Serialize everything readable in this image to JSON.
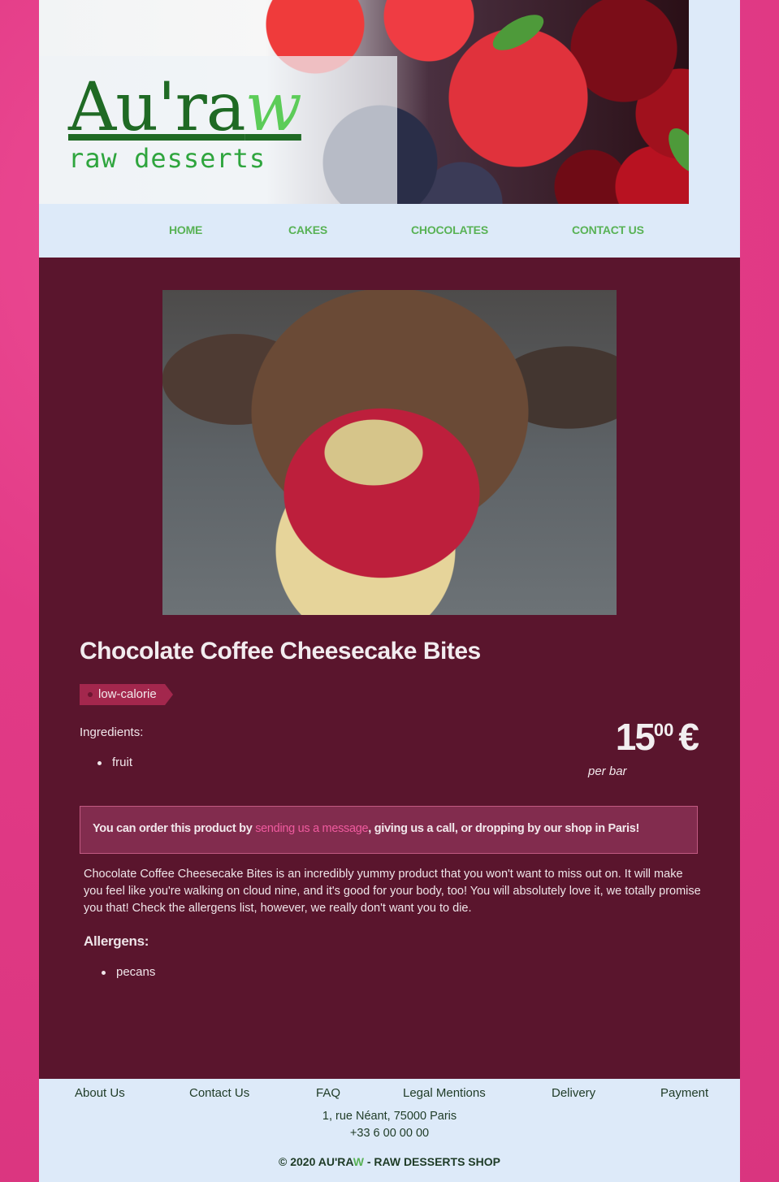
{
  "brand": {
    "logo_main": "Au'ra",
    "logo_accent": "w",
    "tagline": "raw desserts"
  },
  "nav": {
    "home": "HOME",
    "cakes": "CAKES",
    "chocolates": "CHOCOLATES",
    "contact": "CONTACT US"
  },
  "product": {
    "title": "Chocolate Coffee Cheesecake Bites",
    "tag": "low-calorie",
    "ingredients_label": "Ingredients:",
    "ingredients": [
      "fruit"
    ],
    "price_int": "15",
    "price_cents": "00",
    "currency": "€",
    "per_unit": "per bar",
    "order_prefix": "You can order this product by ",
    "order_link": "sending us a message",
    "order_suffix": ", giving us a call, or dropping by our shop in Paris!",
    "description": "Chocolate Coffee Cheesecake Bites is an incredibly yummy product that you won't want to miss out on. It will make you feel like you're walking on cloud nine, and it's good for your body, too! You will absolutely love it, we totally promise you that! Check the allergens list, however, we really don't want you to die.",
    "allergens_title": "Allergens:",
    "allergens": [
      "pecans"
    ]
  },
  "footer": {
    "links": [
      "About Us",
      "Contact Us",
      "FAQ",
      "Legal Mentions",
      "Delivery",
      "Payment"
    ],
    "address": "1, rue Néant, 75000 Paris",
    "phone": "+33 6 00 00 00",
    "copyright_prefix": "© 2020 AU'RA",
    "copyright_accent": "W",
    "copyright_suffix": " - RAW DESSERTS SHOP"
  },
  "colors": {
    "background": "#e23a86",
    "page": "#ddeaf9",
    "main": "#5a152d",
    "accent_green": "#58b255",
    "link_pink": "#ef5a9e",
    "tag": "#a3274d"
  }
}
